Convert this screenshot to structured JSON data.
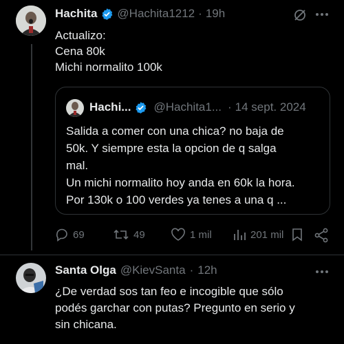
{
  "tweet": {
    "author_name": "Hachita",
    "handle": "@Hachita1212",
    "separator": "·",
    "time": "19h",
    "lines": [
      "Actualizo:",
      "Cena 80k",
      "Michi normalito 100k"
    ]
  },
  "quoted": {
    "author_name": "Hachi...",
    "handle": "@Hachita1...",
    "separator": "·",
    "date": "14 sept. 2024",
    "lines": [
      "Salida a comer con una chica? no baja de",
      "50k. Y siempre esta la opcion  de q salga",
      "mal.",
      "Un michi normalito hoy anda en 60k la hora.",
      "Por 130k o 100 verdes ya tenes a una q ..."
    ]
  },
  "actions": {
    "replies": "69",
    "retweets": "49",
    "likes": "1 mil",
    "views": "201 mil"
  },
  "reply": {
    "author_name": "Santa Olga",
    "handle": "@KievSanta",
    "separator": "·",
    "time": "12h",
    "lines": [
      "¿De verdad sos tan feo e incogible que sólo",
      "podés garchar con putas? Pregunto en serio y",
      "sin chicana."
    ]
  },
  "colors": {
    "background": "#000000",
    "text": "#e7e9ea",
    "muted": "#71767b",
    "verified": "#1d9bf0",
    "border": "#2f3336"
  }
}
